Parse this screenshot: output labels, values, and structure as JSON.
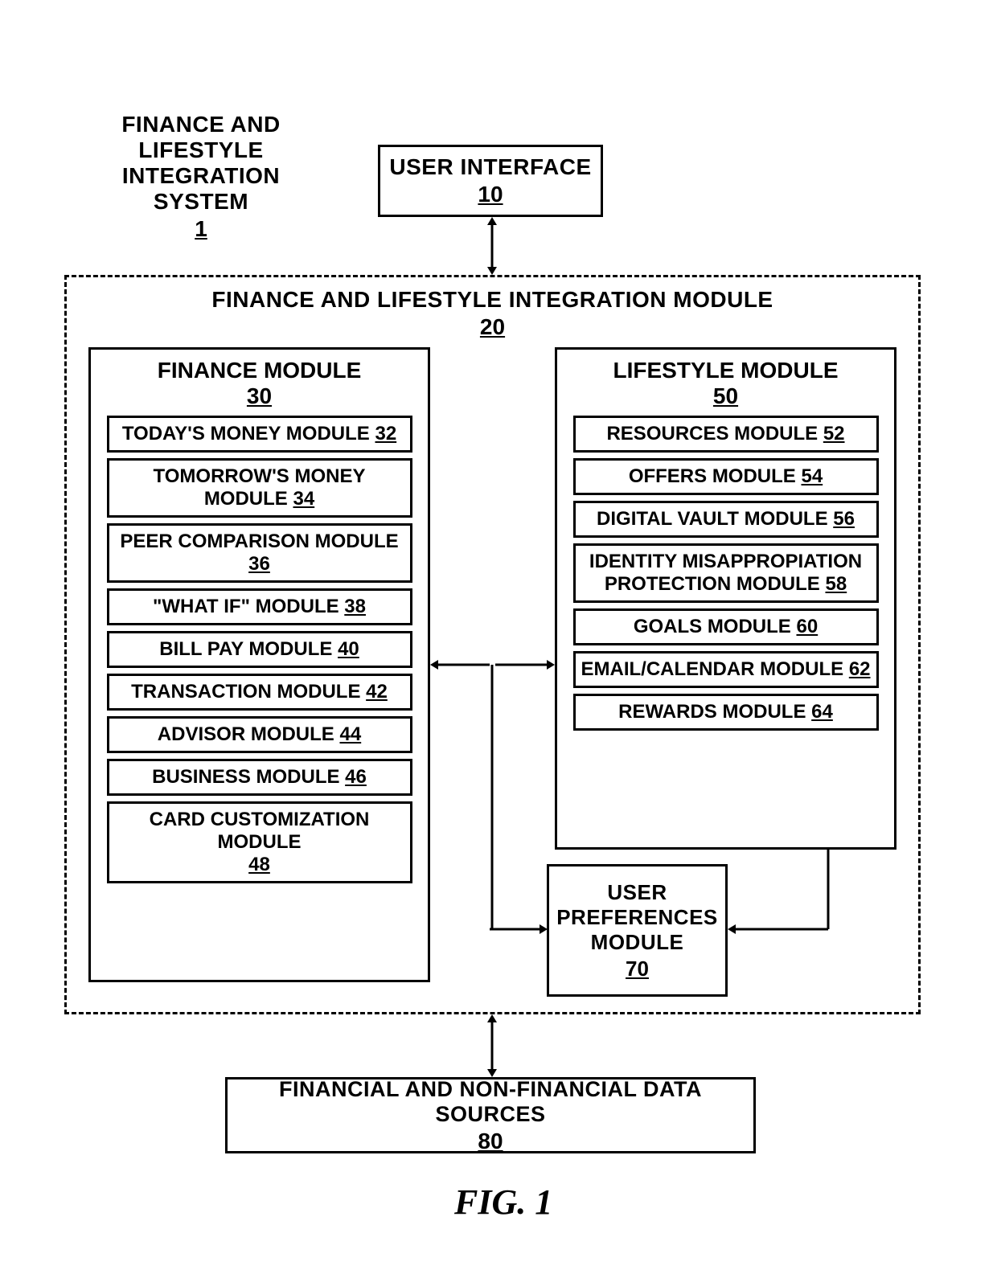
{
  "caption": "FIG. 1",
  "system": {
    "title_l1": "FINANCE AND LIFESTYLE",
    "title_l2": "INTEGRATION SYSTEM",
    "num": "1"
  },
  "user_interface": {
    "title": "USER INTERFACE",
    "num": "10"
  },
  "integration_module": {
    "title": "FINANCE AND LIFESTYLE INTEGRATION MODULE",
    "num": "20"
  },
  "finance_module": {
    "title": "FINANCE MODULE",
    "num": "30",
    "items": [
      {
        "label": "TODAY'S MONEY MODULE",
        "num": "32"
      },
      {
        "label": "TOMORROW'S MONEY MODULE",
        "num": "34"
      },
      {
        "label": "PEER COMPARISON MODULE",
        "num": "36"
      },
      {
        "label": "\"WHAT IF\" MODULE",
        "num": "38"
      },
      {
        "label": "BILL PAY MODULE",
        "num": "40"
      },
      {
        "label": "TRANSACTION MODULE",
        "num": "42"
      },
      {
        "label": "ADVISOR MODULE",
        "num": "44"
      },
      {
        "label": "BUSINESS MODULE",
        "num": "46"
      },
      {
        "label": "CARD CUSTOMIZATION MODULE",
        "num": "48"
      }
    ]
  },
  "lifestyle_module": {
    "title": "LIFESTYLE MODULE",
    "num": "50",
    "items": [
      {
        "label": "RESOURCES MODULE",
        "num": "52"
      },
      {
        "label": "OFFERS MODULE",
        "num": "54"
      },
      {
        "label": "DIGITAL VAULT MODULE",
        "num": "56"
      },
      {
        "label": "IDENTITY MISAPPROPIATION PROTECTION MODULE",
        "num": "58"
      },
      {
        "label": "GOALS MODULE",
        "num": "60"
      },
      {
        "label": "EMAIL/CALENDAR MODULE",
        "num": "62"
      },
      {
        "label": "REWARDS MODULE",
        "num": "64"
      }
    ]
  },
  "user_prefs": {
    "title_l1": "USER",
    "title_l2": "PREFERENCES",
    "title_l3": "MODULE",
    "num": "70"
  },
  "data_sources": {
    "title": "FINANCIAL AND NON-FINANCIAL DATA SOURCES",
    "num": "80"
  }
}
